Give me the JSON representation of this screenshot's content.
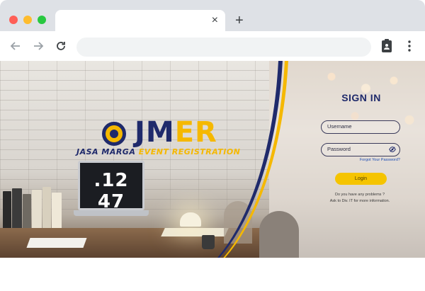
{
  "browser": {
    "tab_close": "×",
    "new_tab": "+",
    "icons": [
      "back-arrow-icon",
      "forward-arrow-icon",
      "reload-icon",
      "clipboard-icon",
      "more-vert-icon"
    ]
  },
  "hero": {
    "clock_time": ".12 47",
    "logo": {
      "jm": "JM",
      "er": "ER",
      "sub_left": "JASA MARGA",
      "sub_right": "EVENT REGISTRATION"
    }
  },
  "signin": {
    "title": "SIGN IN",
    "username_placeholder": "Username",
    "password_placeholder": "Password",
    "forgot": "Forgot Your Password?",
    "login_label": "Login",
    "help_line1": "Do you have any problems ?",
    "help_line2": "Ask to Div. IT for more information."
  },
  "colors": {
    "brand_navy": "#1f2a6b",
    "brand_yellow": "#f5b800",
    "button_yellow": "#f5c400"
  }
}
